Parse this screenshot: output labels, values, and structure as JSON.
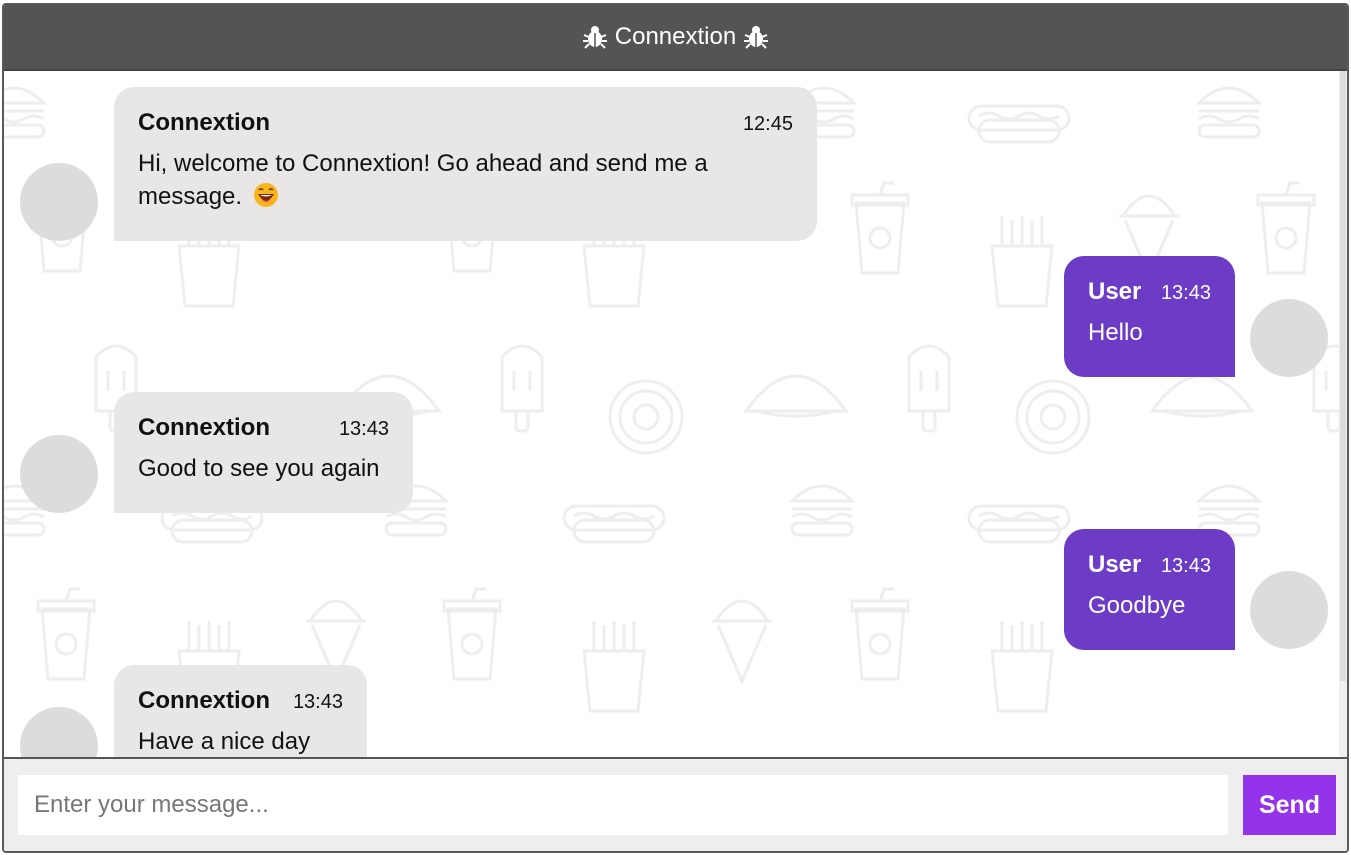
{
  "header": {
    "title": "Connextion",
    "left_icon": "bug-icon",
    "right_icon": "bug-icon"
  },
  "messages": [
    {
      "sender": "Connextion",
      "time": "12:45",
      "text": "Hi, welcome to Connextion! Go ahead and send me a message.",
      "emoji": "grinning-face-emoji",
      "from": "bot"
    },
    {
      "sender": "User",
      "time": "13:43",
      "text": "Hello",
      "from": "user"
    },
    {
      "sender": "Connextion",
      "time": "13:43",
      "text": "Good to see you again",
      "from": "bot"
    },
    {
      "sender": "User",
      "time": "13:43",
      "text": "Goodbye",
      "from": "user"
    },
    {
      "sender": "Connextion",
      "time": "13:43",
      "text": "Have a nice day",
      "from": "bot"
    }
  ],
  "composer": {
    "placeholder": "Enter your message...",
    "send_label": "Send"
  },
  "colors": {
    "header": "#555354",
    "bot_bubble": "#e8e7e6",
    "user_bubble": "#6c3cc6",
    "send_button": "#9333ea"
  }
}
